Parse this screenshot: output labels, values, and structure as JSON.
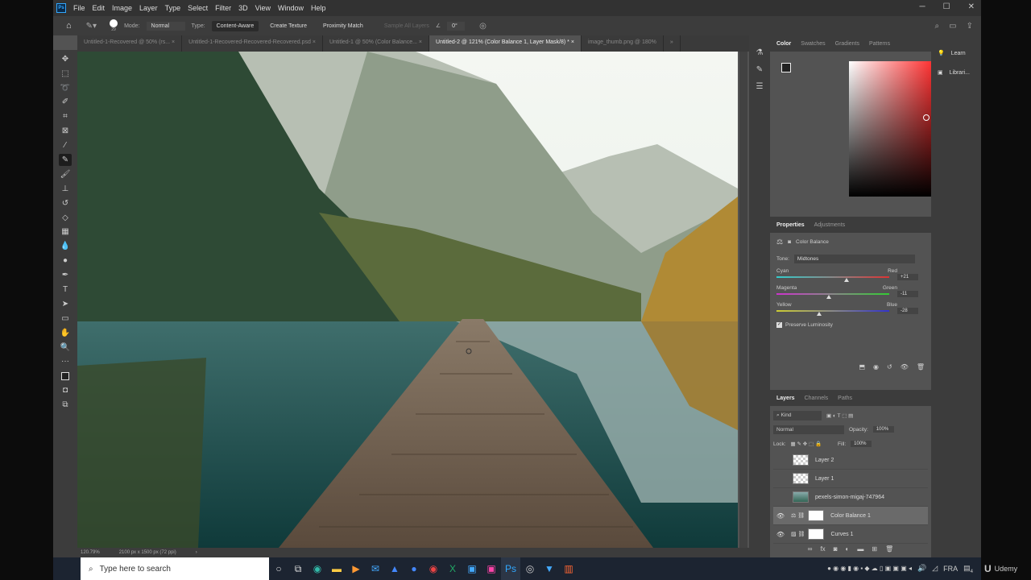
{
  "menu": [
    "File",
    "Edit",
    "Image",
    "Layer",
    "Type",
    "Select",
    "Filter",
    "3D",
    "View",
    "Window",
    "Help"
  ],
  "options": {
    "brush_size": "29",
    "mode_label": "Mode:",
    "mode": "Normal",
    "type_label": "Type:",
    "type_buttons": [
      "Content-Aware",
      "Create Texture",
      "Proximity Match"
    ],
    "sample_all": "Sample All Layers",
    "angle": "0°"
  },
  "tabs": [
    "Untitled-1-Recovered @ 50% (rs...",
    "Untitled-1-Recovered-Recovered-Recovered.psd",
    "Untitled-1 @ 50% (Color Balance...",
    "Untitled-2 @ 121% (Color Balance 1, Layer Mask/8) *",
    "image_thumb.png @ 180%"
  ],
  "status": {
    "zoom": "120.79%",
    "doc": "2100 px x 1500 px (72 ppi)"
  },
  "color_panel": {
    "tabs": [
      "Color",
      "Swatches",
      "Gradients",
      "Patterns"
    ]
  },
  "learn_panel": {
    "items": [
      "Learn",
      "Librari..."
    ]
  },
  "properties": {
    "tabs": [
      "Properties",
      "Adjustments"
    ],
    "title": "Color Balance",
    "tone_label": "Tone:",
    "tone": "Midtones",
    "sliders": [
      {
        "left": "Cyan",
        "right": "Red",
        "value": "+21",
        "pos": 0.6
      },
      {
        "left": "Magenta",
        "right": "Green",
        "value": "-11",
        "pos": 0.44
      },
      {
        "left": "Yellow",
        "right": "Blue",
        "value": "-28",
        "pos": 0.36
      }
    ],
    "preserve": "Preserve Luminosity"
  },
  "layers_panel": {
    "tabs": [
      "Layers",
      "Channels",
      "Paths"
    ],
    "kind": "Kind",
    "blend": "Normal",
    "opacity_label": "Opacity:",
    "opacity": "100%",
    "lock_label": "Lock:",
    "fill_label": "Fill:",
    "fill": "100%",
    "layers": [
      {
        "name": "Layer 2",
        "visible": false
      },
      {
        "name": "Layer 1",
        "visible": false
      },
      {
        "name": "pexels-simon-migaj-747964",
        "visible": false
      },
      {
        "name": "Color Balance 1",
        "visible": true,
        "selected": true
      },
      {
        "name": "Curves 1",
        "visible": true
      }
    ]
  },
  "taskbar": {
    "search_placeholder": "Type here to search",
    "lang": "FRA",
    "notifications": "4"
  },
  "watermark": "Udemy",
  "colors": {
    "accent": "#31a8ff",
    "panel": "#535353",
    "dark": "#3c3c3c"
  }
}
